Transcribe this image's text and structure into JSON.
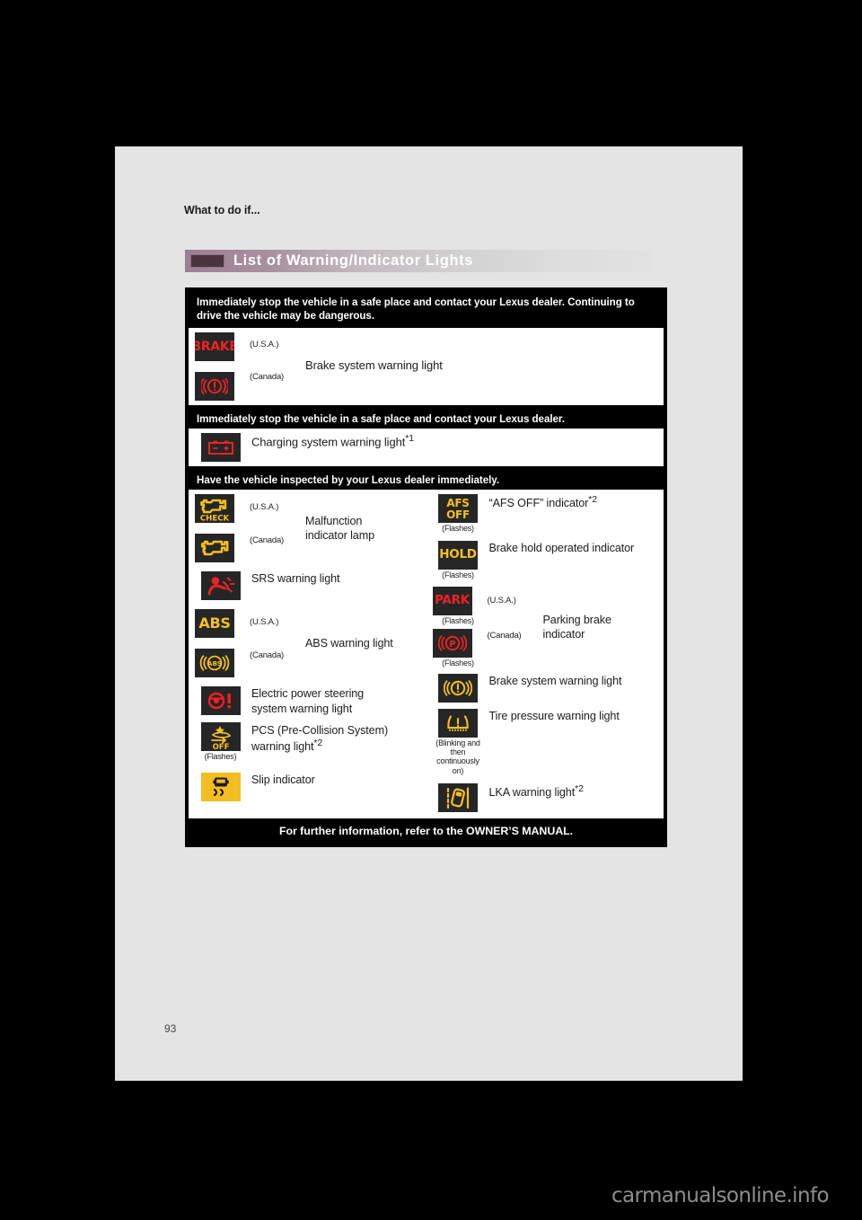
{
  "document": {
    "breadcrumb": "What to do if...",
    "page_number": "93",
    "watermark": "carmanualsonline.info"
  },
  "section": {
    "title": "List of Warning/Indicator Lights"
  },
  "groups": [
    {
      "heading": "Immediately stop the vehicle in a safe place and contact your Lexus dealer. Continuing to drive the vehicle may be dangerous.",
      "layout": "single-pair",
      "rows": [
        {
          "label": "Brake system warning light",
          "variants": [
            {
              "icon": "brake-text-icon",
              "icon_text": "BRAKE",
              "color": "#ef2122",
              "region": "(U.S.A.)"
            },
            {
              "icon": "brake-circle-exclamation-icon",
              "color": "#ef2122",
              "region": "(Canada)"
            }
          ]
        }
      ]
    },
    {
      "heading": "Immediately stop the vehicle in a safe place and contact your Lexus dealer.",
      "layout": "single",
      "rows": [
        {
          "label": "Charging system warning light",
          "sup": "*1",
          "icon": "battery-icon",
          "color": "#ef2122"
        }
      ]
    },
    {
      "heading": "Have the vehicle inspected by your Lexus dealer immediately.",
      "layout": "two-column",
      "left": [
        {
          "label": "Malfunction indicator lamp",
          "variants": [
            {
              "icon": "check-engine-check-icon",
              "color": "#f5c021",
              "region": "(U.S.A.)"
            },
            {
              "icon": "check-engine-icon",
              "color": "#f5c021",
              "region": "(Canada)"
            }
          ]
        },
        {
          "label": "SRS warning light",
          "icon": "srs-airbag-icon",
          "color": "#ef2122"
        },
        {
          "label": "ABS warning light",
          "variants": [
            {
              "icon": "abs-text-icon",
              "icon_text": "ABS",
              "color": "#f5c021",
              "region": "(U.S.A.)"
            },
            {
              "icon": "abs-circle-icon",
              "color": "#f5c021",
              "region": "(Canada)"
            }
          ]
        },
        {
          "label": "Electric power steering system warning light",
          "icon": "power-steering-icon",
          "color": "#ef2122"
        },
        {
          "label": "PCS (Pre-Collision System) warning light",
          "sup": "*2",
          "icon": "pcs-off-icon",
          "color": "#f5c021",
          "note": "(Flashes)"
        },
        {
          "label": "Slip indicator",
          "icon": "slip-indicator-icon",
          "color": "#1c1c1c"
        }
      ],
      "right": [
        {
          "label": "“AFS OFF” indicator",
          "sup": "*2",
          "icon": "afs-off-icon",
          "icon_text": "AFS OFF",
          "color": "#f5c021",
          "note": "(Flashes)"
        },
        {
          "label": "Brake hold operated indicator",
          "icon": "hold-icon",
          "icon_text": "HOLD",
          "color": "#f5c021",
          "note": "(Flashes)"
        },
        {
          "label": "Parking brake indicator",
          "variants": [
            {
              "icon": "park-text-icon",
              "icon_text": "PARK",
              "color": "#ef2122",
              "region": "(U.S.A.)",
              "note": "(Flashes)"
            },
            {
              "icon": "parking-brake-p-icon",
              "color": "#ef2122",
              "region": "(Canada)",
              "note": "(Flashes)"
            }
          ]
        },
        {
          "label": "Brake system warning light",
          "icon": "brake-circle-exclamation-amber-icon",
          "color": "#f5c021"
        },
        {
          "label": "Tire pressure warning light",
          "icon": "tire-pressure-icon",
          "color": "#f5c021",
          "note": "(Blinking and then continuously on)"
        },
        {
          "label": "LKA warning light",
          "sup": "*2",
          "icon": "lka-icon",
          "color": "#f5c021"
        }
      ]
    }
  ],
  "footer": {
    "text": "For further information, refer to the OWNER’S MANUAL."
  }
}
